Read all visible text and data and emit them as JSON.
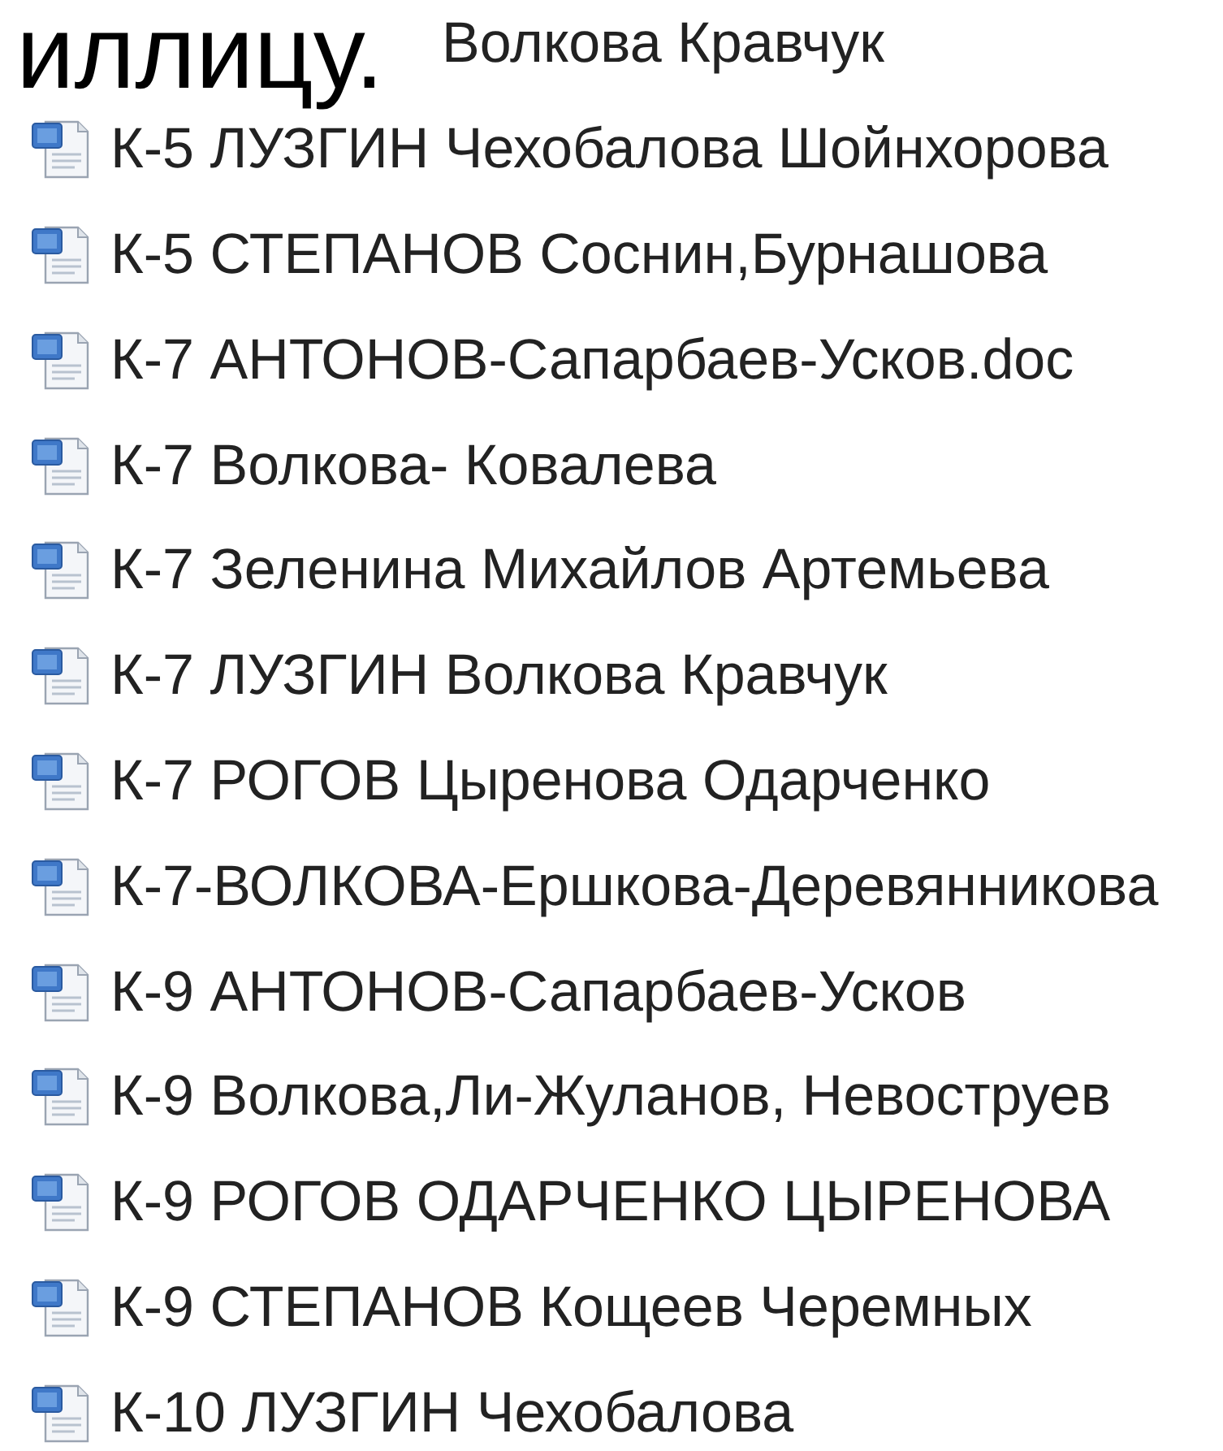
{
  "overlay_text": "иллицу.",
  "files": [
    {
      "name": "Волкова Кравчук",
      "covered": true
    },
    {
      "name": "К-5 ЛУЗГИН Чехобалова Шойнхорова"
    },
    {
      "name": "К-5 СТЕПАНОВ Соснин,Бурнашова"
    },
    {
      "name": "К-7 АНТОНОВ-Сапарбаев-Усков.doc"
    },
    {
      "name": "К-7 Волкова- Ковалева"
    },
    {
      "name": "К-7 Зеленина Михайлов Артемьева"
    },
    {
      "name": "К-7 ЛУЗГИН Волкова Кравчук"
    },
    {
      "name": "К-7 РОГОВ Цыренова Одарченко"
    },
    {
      "name": "К-7-ВОЛКОВА-Ершкова-Деревянникова"
    },
    {
      "name": "К-9 АНТОНОВ-Сапарбаев-Усков"
    },
    {
      "name": "К-9 Волкова,Ли-Жуланов, Невоструев"
    },
    {
      "name": "К-9 РОГОВ ОДАРЧЕНКО ЦЫРЕНОВА"
    },
    {
      "name": "К-9 СТЕПАНОВ Кощеев Черемных"
    },
    {
      "name": "К-10 ЛУЗГИН Чехобалова"
    }
  ]
}
